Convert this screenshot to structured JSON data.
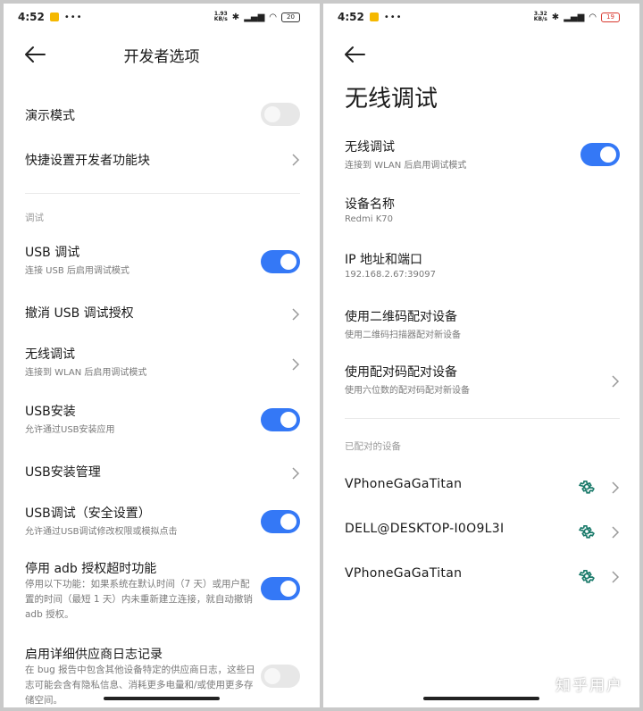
{
  "status_left": {
    "time": "4:52",
    "dots": "•••",
    "speed": "1.93\nKB/s",
    "battery": "20"
  },
  "status_right": {
    "time": "4:52",
    "dots": "•••",
    "speed": "3.32\nKB/s",
    "battery": "19"
  },
  "developer_options": {
    "title": "开发者选项",
    "items": [
      {
        "title": "演示模式",
        "toggle": false
      },
      {
        "title": "快捷设置开发者功能块"
      },
      {
        "section": "调试"
      },
      {
        "title": "USB 调试",
        "subtitle": "连接 USB 后启用调试模式",
        "toggle": true
      },
      {
        "title": "撤消 USB 调试授权"
      },
      {
        "title": "无线调试",
        "subtitle": "连接到 WLAN 后启用调试模式"
      },
      {
        "title": "USB安装",
        "subtitle": "允许通过USB安装应用",
        "toggle": true
      },
      {
        "title": "USB安装管理"
      },
      {
        "title": "USB调试（安全设置）",
        "subtitle": "允许通过USB调试修改权限或模拟点击",
        "toggle": true
      },
      {
        "title": "停用 adb 授权超时功能",
        "description": "停用以下功能：如果系统在默认时间（7 天）或用户配置的时间（最短 1 天）内未重新建立连接，就自动撤销 adb 授权。",
        "toggle": true
      },
      {
        "title": "启用详细供应商日志记录",
        "description": "在 bug 报告中包含其他设备特定的供应商日志，这些日志可能会含有隐私信息、消耗更多电量和/或使用更多存储空间。",
        "toggle": false
      }
    ]
  },
  "wireless_debugging": {
    "title": "无线调试",
    "toggle_title": "无线调试",
    "toggle_subtitle": "连接到 WLAN 后启用调试模式",
    "toggle_on": true,
    "device_name_label": "设备名称",
    "device_name_value": "Redmi K70",
    "ip_label": "IP 地址和端口",
    "ip_value": "192.168.2.67:39097",
    "qr_title": "使用二维码配对设备",
    "qr_subtitle": "使用二维码扫描器配对新设备",
    "code_title": "使用配对码配对设备",
    "code_subtitle": "使用六位数的配对码配对新设备",
    "paired_label": "已配对的设备",
    "paired_devices": [
      "VPhoneGaGaTitan",
      "DELL@DESKTOP-I0O9L3I",
      "VPhoneGaGaTitan"
    ]
  },
  "watermark": "知乎用户",
  "colors": {
    "toggle_on": "#3478f6",
    "gear": "#1a7a6a",
    "toggle_off": "#e7e7e7"
  }
}
